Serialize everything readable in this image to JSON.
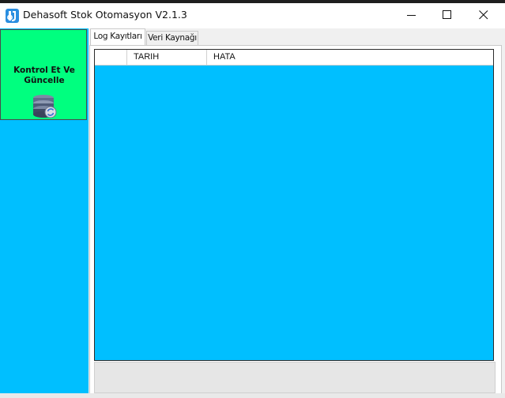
{
  "window": {
    "title": "Dehasoft Stok Otomasyon V2.1.3",
    "icon": "dehasoft-logo-icon",
    "controls": [
      "minimize-icon",
      "maximize-icon",
      "close-icon"
    ]
  },
  "sidebar": {
    "action_button": {
      "label": "Kontrol Et Ve Güncelle",
      "icon": "database-sync-icon",
      "color": "#00ff7f"
    },
    "background": "#00bfff"
  },
  "tabs": [
    {
      "label": "Log Kayıtları",
      "selected": true
    },
    {
      "label": "Veri Kaynağı",
      "selected": false
    }
  ],
  "log_grid": {
    "columns": [
      "",
      "TARIH",
      "HATA"
    ],
    "rows": [],
    "background": "#00bfff"
  }
}
